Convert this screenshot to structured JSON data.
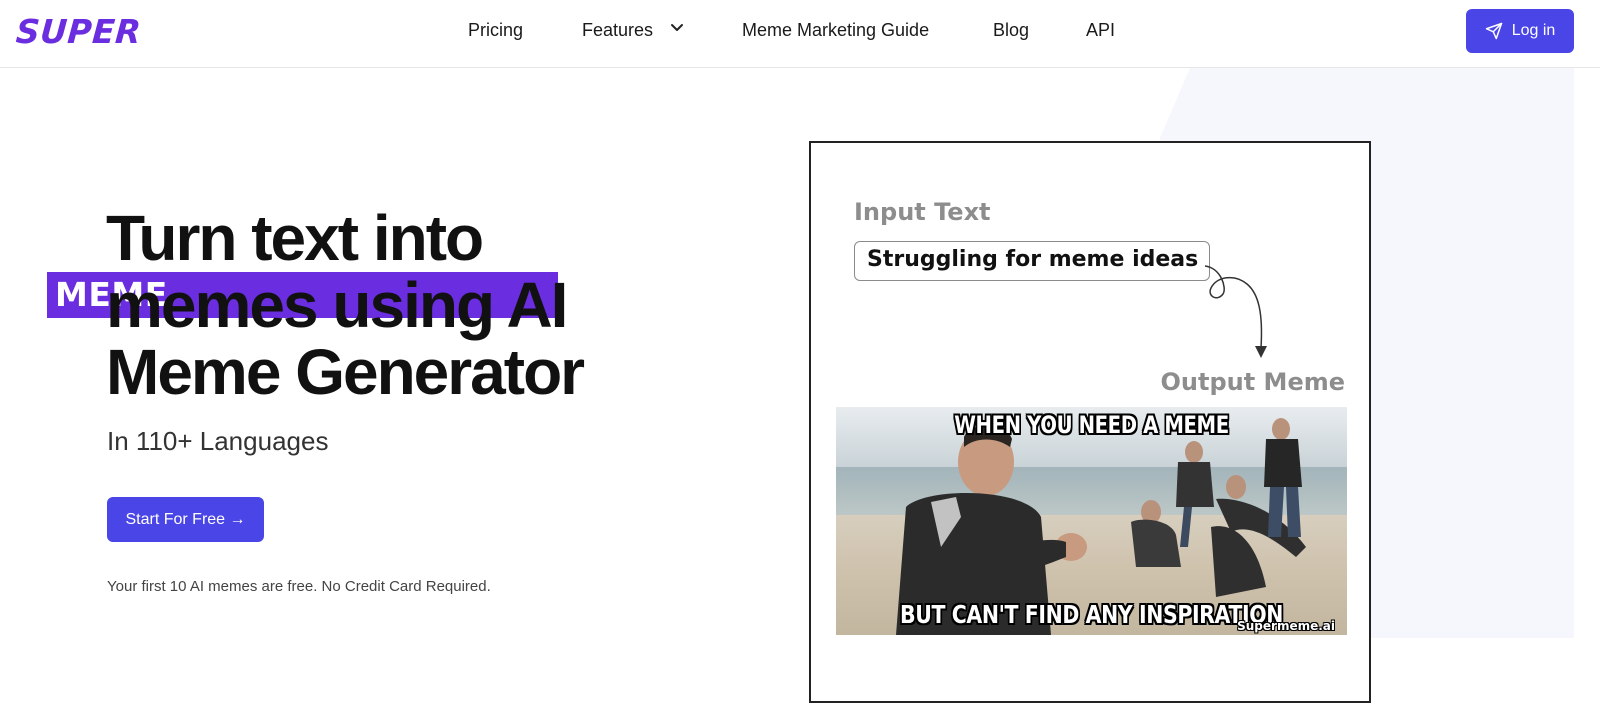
{
  "header": {
    "logo": {
      "part1": "SUPER",
      "part2": "MEME"
    },
    "nav": {
      "pricing": "Pricing",
      "features": "Features",
      "guide": "Meme Marketing Guide",
      "blog": "Blog",
      "api": "API"
    },
    "login_label": "Log in"
  },
  "hero": {
    "title": "Turn text into memes using AI Meme Generator",
    "subtitle": "In 110+ Languages",
    "cta_label": "Start For Free →",
    "note": "Your first 10 AI memes are free. No Credit Card Required."
  },
  "demo": {
    "input_label": "Input Text",
    "input_text": "Struggling for meme ideas",
    "output_label": "Output Meme",
    "meme_top": "WHEN YOU NEED A MEME",
    "meme_bottom": "BUT CAN'T FIND ANY INSPIRATION",
    "watermark": "Supermeme.ai"
  },
  "colors": {
    "brand": "#6a2ddf",
    "accent": "#4a45e6"
  },
  "icons": {
    "features_chevron": "chevron-down-icon",
    "login": "paper-plane-icon"
  }
}
